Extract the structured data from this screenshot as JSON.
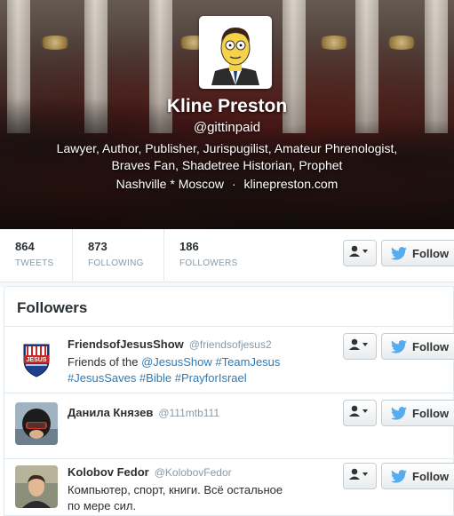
{
  "profile": {
    "name": "Kline Preston",
    "handle": "@gittinpaid",
    "bio": "Lawyer, Author, Publisher, Jurispugilist, Amateur Phrenologist, Braves Fan, Shadetree Historian, Prophet",
    "location": "Nashville * Moscow",
    "separator": "·",
    "website": "klinepreston.com"
  },
  "stats": [
    {
      "value": "864",
      "label": "TWEETS"
    },
    {
      "value": "873",
      "label": "FOLLOWING"
    },
    {
      "value": "186",
      "label": "FOLLOWERS"
    }
  ],
  "actions": {
    "follow_label": "Follow"
  },
  "followers": {
    "title": "Followers",
    "items": [
      {
        "name": "FriendsofJesusShow",
        "screen_name": "@friendsofjesus2",
        "bio_parts": [
          {
            "text": "Friends of the ",
            "link": false
          },
          {
            "text": "@JesusShow",
            "link": true
          },
          {
            "text": " ",
            "link": false
          },
          {
            "text": "#TeamJesus",
            "link": true
          },
          {
            "text": " ",
            "link": false
          },
          {
            "text": "#JesusSaves",
            "link": true
          },
          {
            "text": " ",
            "link": false
          },
          {
            "text": "#Bible",
            "link": true
          },
          {
            "text": " ",
            "link": false
          },
          {
            "text": "#PrayforIsrael",
            "link": true
          }
        ],
        "avatar_text": "JESUS"
      },
      {
        "name": "Данила Князев",
        "screen_name": "@111mtb111",
        "bio_parts": []
      },
      {
        "name": "Kolobov Fedor",
        "screen_name": "@KolobovFedor",
        "bio_parts": [
          {
            "text": "Компьютер, спорт, книги. Всё остальное",
            "link": false
          },
          {
            "text": "по мере сил.",
            "link": false
          }
        ]
      }
    ]
  },
  "colors": {
    "link": "#2b7bb9",
    "twitter_blue": "#55acee",
    "muted": "#8899a6"
  }
}
